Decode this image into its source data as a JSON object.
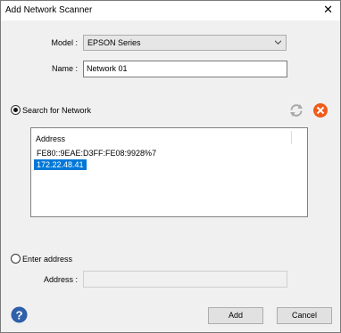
{
  "dialog": {
    "title": "Add Network Scanner"
  },
  "model": {
    "label": "Model :",
    "value": "EPSON Series"
  },
  "name": {
    "label": "Name :",
    "value": "Network 01"
  },
  "search": {
    "label": "Search for Network",
    "selected": true,
    "list_header": "Address",
    "addresses": [
      "FE80::9EAE:D3FF:FE08:9928%7",
      "172.22.48.41"
    ],
    "selected_address": "172.22.48.41"
  },
  "enter_address": {
    "label": "Enter address",
    "selected": false,
    "field_label": "Address :",
    "value": ""
  },
  "buttons": {
    "add": "Add",
    "cancel": "Cancel"
  },
  "icons": {
    "refresh": "refresh-icon",
    "clear": "clear-icon",
    "help": "help-icon",
    "accent_orange": "#f05a1a",
    "help_blue": "#2f5fa8"
  }
}
